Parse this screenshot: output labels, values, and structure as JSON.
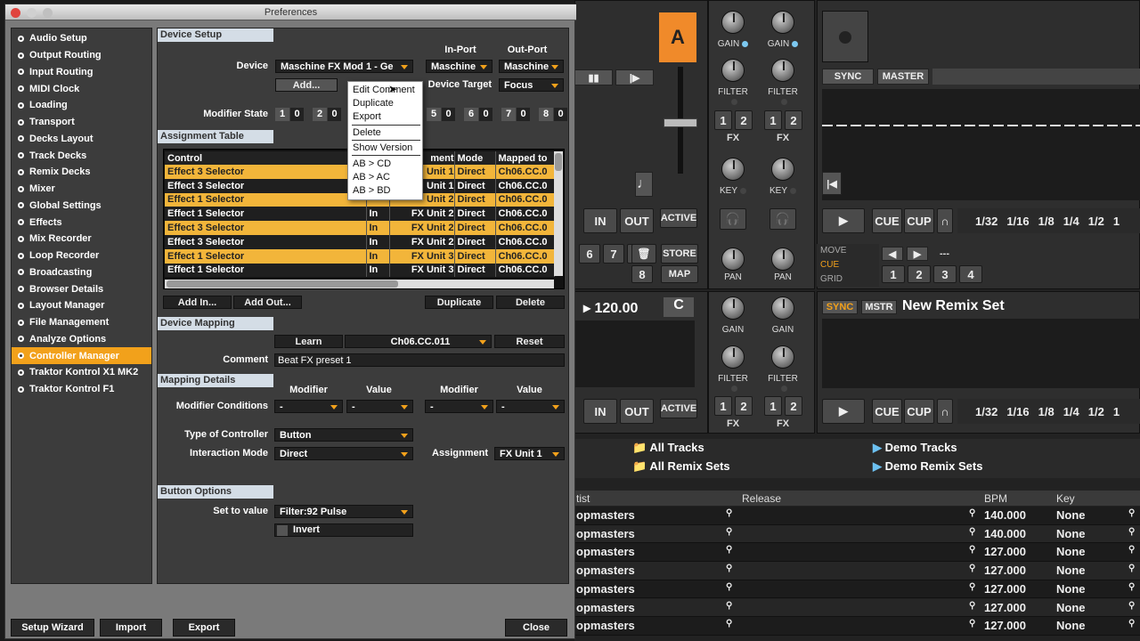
{
  "window_title": "Preferences",
  "sidebar": {
    "items": [
      "Audio Setup",
      "Output Routing",
      "Input Routing",
      "MIDI Clock",
      "Loading",
      "Transport",
      "Decks Layout",
      "Track Decks",
      "Remix Decks",
      "Mixer",
      "Global Settings",
      "Effects",
      "Mix Recorder",
      "Loop Recorder",
      "Broadcasting",
      "Browser Details",
      "Layout Manager",
      "File Management",
      "Analyze Options",
      "Controller Manager",
      "Traktor Kontrol X1 MK2",
      "Traktor Kontrol F1"
    ],
    "selected": "Controller Manager"
  },
  "device_setup": {
    "section": "Device Setup",
    "device_label": "Device",
    "device_value": "Maschine FX Mod 1 - Ge",
    "in_port_header": "In-Port",
    "out_port_header": "Out-Port",
    "in_port_value": "Maschine",
    "out_port_value": "Maschine",
    "add_button": "Add...",
    "device_target_label": "Device Target",
    "device_target_value": "Focus",
    "modifier_state_label": "Modifier State",
    "modifiers": [
      [
        "1",
        "0"
      ],
      [
        "2",
        "0"
      ],
      [
        "5",
        "0"
      ],
      [
        "6",
        "0"
      ],
      [
        "7",
        "0"
      ],
      [
        "8",
        "0"
      ]
    ]
  },
  "context_menu": {
    "items": [
      "Edit Comment",
      "Duplicate",
      "Export",
      "Delete",
      "Show Version",
      "AB > CD",
      "AB > AC",
      "AB > BD"
    ]
  },
  "assignment_table": {
    "section": "Assignment Table",
    "headers": [
      "Control",
      "",
      "Assignment",
      "Mode",
      "Mapped to"
    ],
    "header_partial": "ment",
    "rows": [
      {
        "control": "Effect 3 Selector",
        "io": "",
        "assign": "Unit 1",
        "mode": "Direct",
        "mapped": "Ch06.CC.0",
        "hl": true
      },
      {
        "control": "Effect 3 Selector",
        "io": "",
        "assign": "Unit 1",
        "mode": "Direct",
        "mapped": "Ch06.CC.0",
        "hl": false
      },
      {
        "control": "Effect 1 Selector",
        "io": "",
        "assign": "Unit 2",
        "mode": "Direct",
        "mapped": "Ch06.CC.0",
        "hl": true
      },
      {
        "control": "Effect 1 Selector",
        "io": "In",
        "assign": "FX Unit 2",
        "mode": "Direct",
        "mapped": "Ch06.CC.0",
        "hl": false
      },
      {
        "control": "Effect 3 Selector",
        "io": "In",
        "assign": "FX Unit 2",
        "mode": "Direct",
        "mapped": "Ch06.CC.0",
        "hl": true
      },
      {
        "control": "Effect 3 Selector",
        "io": "In",
        "assign": "FX Unit 2",
        "mode": "Direct",
        "mapped": "Ch06.CC.0",
        "hl": false
      },
      {
        "control": "Effect 1 Selector",
        "io": "In",
        "assign": "FX Unit 3",
        "mode": "Direct",
        "mapped": "Ch06.CC.0",
        "hl": true
      },
      {
        "control": "Effect 1 Selector",
        "io": "In",
        "assign": "FX Unit 3",
        "mode": "Direct",
        "mapped": "Ch06.CC.0",
        "hl": false
      }
    ],
    "add_in": "Add In...",
    "add_out": "Add Out...",
    "duplicate": "Duplicate",
    "delete": "Delete"
  },
  "device_mapping": {
    "section": "Device Mapping",
    "learn": "Learn",
    "mapping_value": "Ch06.CC.011",
    "reset": "Reset",
    "comment_label": "Comment",
    "comment_value": "Beat FX preset 1"
  },
  "mapping_details": {
    "section": "Mapping Details",
    "modifier_header": "Modifier",
    "value_header": "Value",
    "modifier_conditions_label": "Modifier Conditions",
    "mod1": "-",
    "val1": "-",
    "mod2": "-",
    "val2": "-",
    "type_label": "Type of Controller",
    "type_value": "Button",
    "interaction_label": "Interaction Mode",
    "interaction_value": "Direct",
    "assignment_label": "Assignment",
    "assignment_value": "FX Unit 1"
  },
  "button_options": {
    "section": "Button Options",
    "set_to_value_label": "Set to value",
    "set_to_value": "Filter:92 Pulse",
    "invert": "Invert"
  },
  "footer": {
    "setup_wizard": "Setup Wizard",
    "import": "Import",
    "export": "Export",
    "close": "Close"
  },
  "traktor": {
    "deck_letter": "A",
    "gain": "GAIN",
    "filter": "FILTER",
    "fx": "FX",
    "key": "KEY",
    "pan": "PAN",
    "one": "1",
    "two": "2",
    "sync": "SYNC",
    "master": "MASTER",
    "mstr": "MSTR",
    "in": "IN",
    "out": "OUT",
    "active": "ACTIVE",
    "cue": "CUE",
    "cup": "CUP",
    "store": "STORE",
    "map": "MAP",
    "seven": "7",
    "eight": "8",
    "six": "6",
    "loop_sizes": [
      "1/32",
      "1/16",
      "1/8",
      "1/4",
      "1/2",
      "1"
    ],
    "move": "MOVE",
    "cue_label": "CUE",
    "grid": "GRID",
    "hotcues": [
      "1",
      "2",
      "3",
      "4"
    ],
    "dashes": "---",
    "tempo": "120.00",
    "key_letter": "C",
    "remix_set": "New Remix Set",
    "browser": {
      "all_tracks": "All Tracks",
      "all_remix": "All Remix Sets",
      "demo_tracks": "Demo Tracks",
      "demo_remix": "Demo Remix Sets",
      "col_artist": "tist",
      "col_release": "Release",
      "col_bpm": "BPM",
      "col_key": "Key",
      "rows": [
        {
          "artist": "opmasters",
          "bpm": "140.000",
          "key": "None"
        },
        {
          "artist": "opmasters",
          "bpm": "140.000",
          "key": "None"
        },
        {
          "artist": "opmasters",
          "bpm": "127.000",
          "key": "None"
        },
        {
          "artist": "opmasters",
          "bpm": "127.000",
          "key": "None"
        },
        {
          "artist": "opmasters",
          "bpm": "127.000",
          "key": "None"
        },
        {
          "artist": "opmasters",
          "bpm": "127.000",
          "key": "None"
        },
        {
          "artist": "opmasters",
          "bpm": "127.000",
          "key": "None"
        }
      ]
    }
  },
  "colors": {
    "accent": "#f2a11b",
    "highlight_row": "#f2b53a",
    "section_header": "#d4dde6",
    "deck_a": "#f08a2a"
  }
}
